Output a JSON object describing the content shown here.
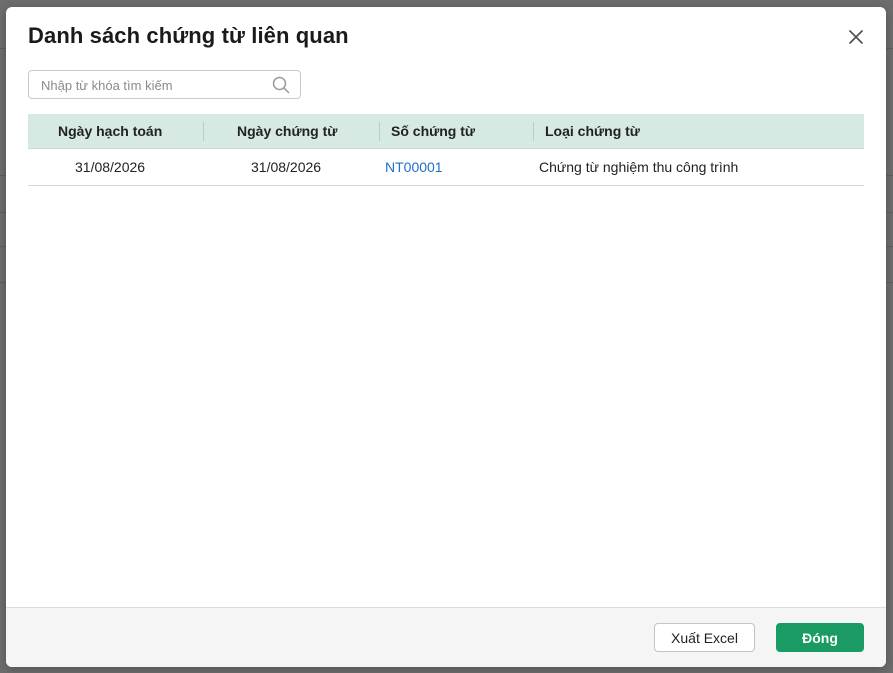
{
  "dialog": {
    "title": "Danh sách chứng từ liên quan",
    "close_icon": "close-icon"
  },
  "search": {
    "placeholder": "Nhập từ khóa tìm kiếm",
    "value": "",
    "icon": "search-icon"
  },
  "table": {
    "columns": [
      "Ngày hạch toán",
      "Ngày chứng từ",
      "Số chứng từ",
      "Loại chứng từ"
    ],
    "rows": [
      {
        "posting_date": "31/08/2026",
        "document_date": "31/08/2026",
        "document_no": "NT00001",
        "document_type": "Chứng từ nghiệm thu công trình"
      }
    ]
  },
  "footer": {
    "export_label": "Xuất Excel",
    "close_label": "Đóng"
  },
  "colors": {
    "header_bg": "#d6e9e2",
    "primary": "#1a9b63",
    "link": "#1f6fd1"
  }
}
